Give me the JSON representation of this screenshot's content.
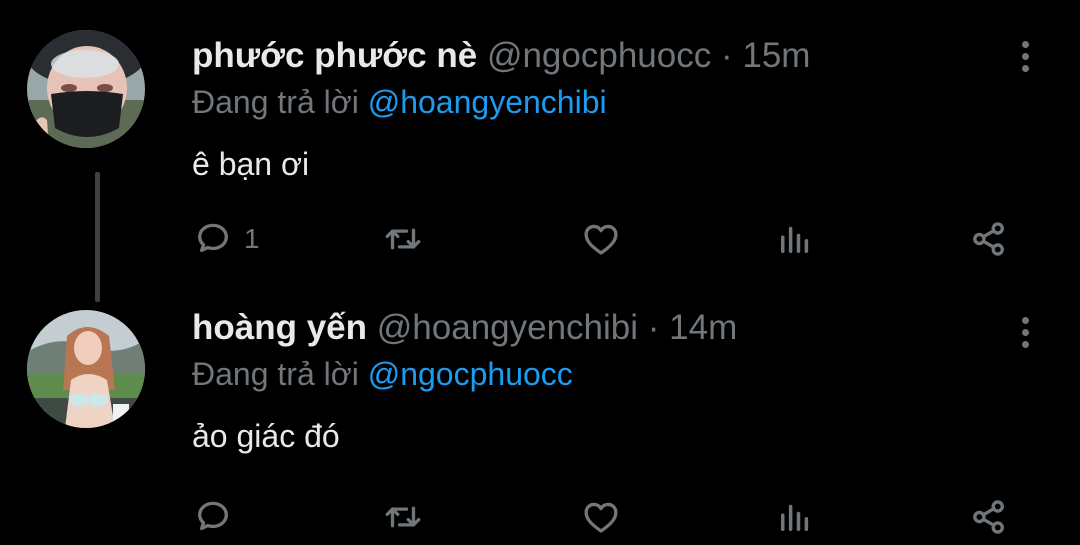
{
  "tweets": [
    {
      "name": "phước phước nè",
      "handle": "@ngocphuocc",
      "separator": "·",
      "time": "15m",
      "reply_prefix": "Đang trả lời",
      "reply_to": "@hoangyenchibi",
      "text": "ê bạn ơi",
      "reply_count": "1"
    },
    {
      "name": "hoàng yến",
      "handle": "@hoangyenchibi",
      "separator": "·",
      "time": "14m",
      "reply_prefix": "Đang trả lời",
      "reply_to": "@ngocphuocc",
      "text": "ảo giác đó",
      "reply_count": ""
    }
  ],
  "icons": [
    "more-icon",
    "reply-icon",
    "retweet-icon",
    "like-icon",
    "views-icon",
    "share-icon"
  ],
  "colors": {
    "background": "#000000",
    "text": "#e7e9ea",
    "muted": "#71767b",
    "link": "#1d9bf0"
  }
}
